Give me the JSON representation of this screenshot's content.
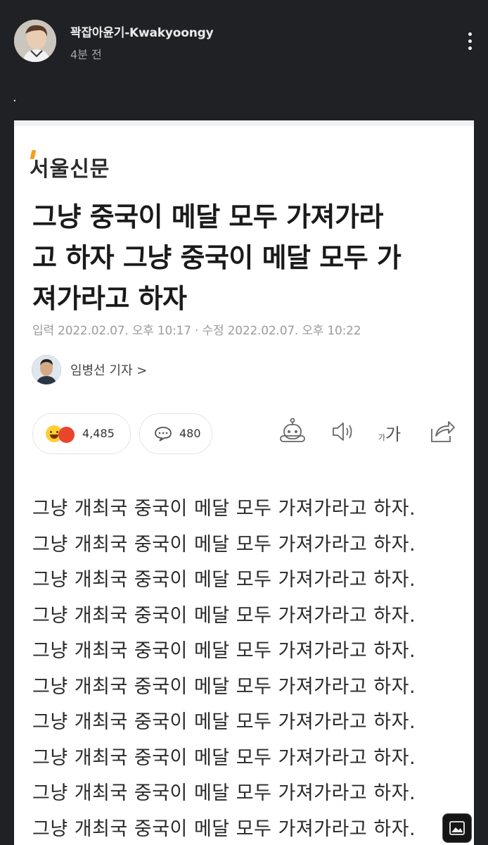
{
  "post": {
    "author_name": "꽉잡아윤기-Kwakyoongy",
    "time_ago": "4분 전",
    "text": "."
  },
  "icons": {
    "more": "more-vertical-icon",
    "robot": "robot-tts-icon",
    "speaker": "speaker-icon",
    "font_size": "font-size-icon",
    "share": "share-icon",
    "image": "image-icon",
    "comment": "comment-bubble-icon"
  },
  "article": {
    "logo": "서울신문",
    "headline_lines": [
      "그냥 중국이 메달 모두 가져가라",
      "고 하자 그냥 중국이 메달 모두 가",
      "져가라고 하자"
    ],
    "dates": "입력 2022.02.07. 오후 10:17 · 수정 2022.02.07. 오후 10:22",
    "reporter": "임병선 기자 >",
    "reaction_count": "4,485",
    "comment_count": "480",
    "font_size_label": "가",
    "body_lines": [
      "그냥 개최국 중국이 메달 모두 가져가라고 하자.",
      "그냥 개최국 중국이 메달 모두 가져가라고 하자.",
      "그냥 개최국 중국이 메달 모두 가져가라고 하자.",
      "그냥 개최국 중국이 메달 모두 가져가라고 하자.",
      "그냥 개최국 중국이 메달 모두 가져가라고 하자.",
      "그냥 개최국 중국이 메달 모두 가져가라고 하자.",
      "그냥 개최국 중국이 메달 모두 가져가라고 하자.",
      "그냥 개최국 중국이 메달 모두 가져가라고 하자.",
      "그냥 개최국 중국이 메달 모두 가져가라고 하자.",
      "그냥 개최국 중국이 메달 모두 가져가라고 하자."
    ]
  },
  "colors": {
    "background": "#202124",
    "card": "#ffffff",
    "logo_accent": "#f3a01c"
  }
}
